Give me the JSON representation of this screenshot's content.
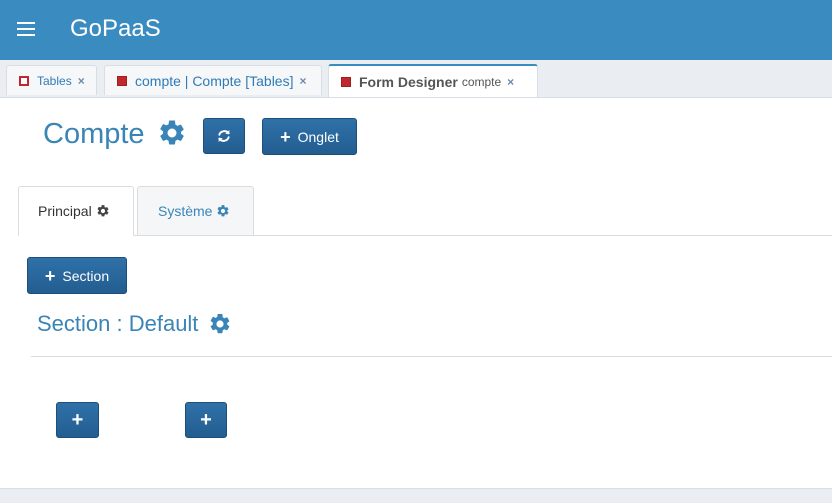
{
  "app": {
    "title": "GoPaaS"
  },
  "tabs": [
    {
      "label": "Tables",
      "close": "×"
    },
    {
      "label": "compte | Compte [Tables]",
      "close": "×"
    },
    {
      "label": "Form Designer",
      "sub": "compte",
      "close": "×"
    }
  ],
  "page": {
    "title": "Compte"
  },
  "toolbar": {
    "onglet_label": "Onglet",
    "plus": "+"
  },
  "inner_tabs": [
    {
      "label": "Principal"
    },
    {
      "label": "Système"
    }
  ],
  "section": {
    "add_label": "Section",
    "title": "Section : Default"
  },
  "add_field_buttons": [
    {
      "label": "+"
    },
    {
      "label": "+"
    }
  ],
  "colors": {
    "header": "#3a8cc0",
    "primary_button": "#2a679c",
    "accent_text": "#3a85b7",
    "tab_marker": "#c0282d"
  }
}
